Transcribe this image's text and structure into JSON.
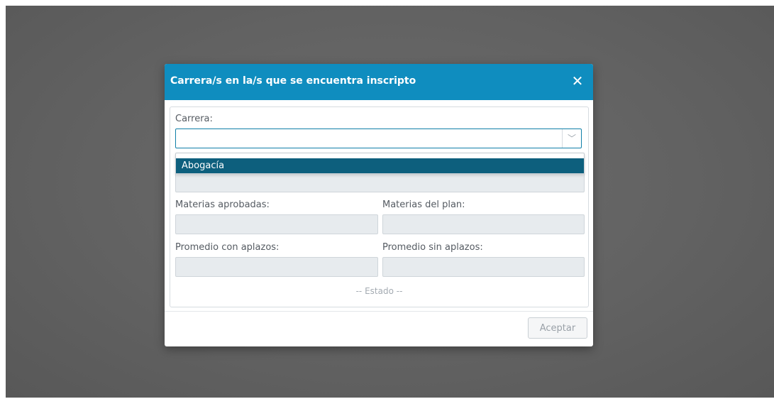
{
  "modal": {
    "title": "Carrera/s en la/s que se encuentra inscripto",
    "close_icon": "close-icon",
    "close_glyph": "✕"
  },
  "form": {
    "carrera_label": "Carrera:",
    "carrera_value": "",
    "chevron_icon": "chevron-down-icon",
    "chevron_glyph": "﹀",
    "dropdown_options": [
      "Abogacía"
    ],
    "highlighted_option": "Abogacía",
    "materias_aprobadas_label": "Materias aprobadas:",
    "materias_aprobadas_value": "",
    "materias_plan_label": "Materias del plan:",
    "materias_plan_value": "",
    "promedio_con_label": "Promedio con aplazos:",
    "promedio_con_value": "",
    "promedio_sin_label": "Promedio sin aplazos:",
    "promedio_sin_value": "",
    "estado_text": "-- Estado --"
  },
  "footer": {
    "accept_label": "Aceptar"
  },
  "colors": {
    "header": "#0f8dbf",
    "option_highlight": "#0d5f7d",
    "backdrop": "#626262"
  }
}
